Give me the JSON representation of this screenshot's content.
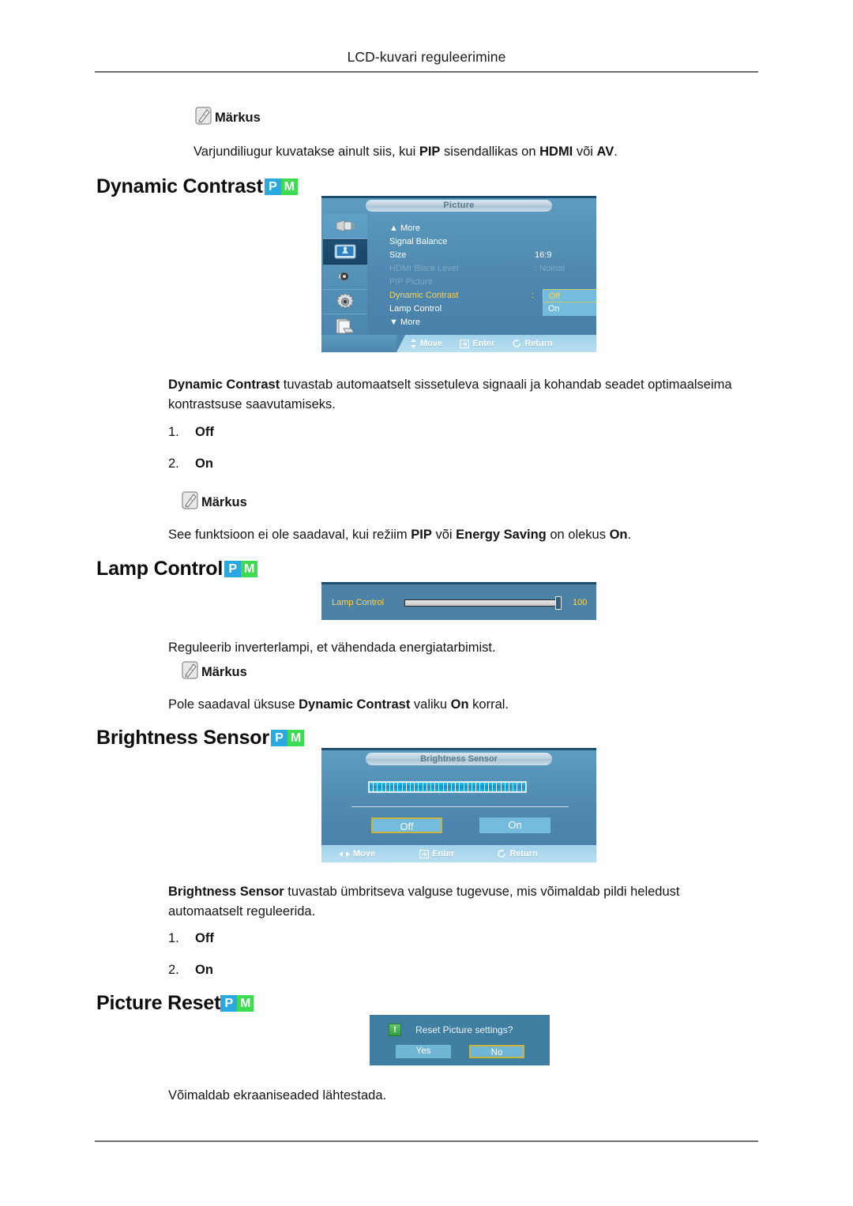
{
  "header": {
    "title": "LCD-kuvari reguleerimine"
  },
  "notes": {
    "label": "Märkus",
    "note1": {
      "pre": "Varjundiliugur kuvatakse ainult siis, kui ",
      "b1": "PIP",
      "mid1": " sisendallikas on ",
      "b2": "HDMI",
      "mid2": " või ",
      "b3": "AV",
      "post": "."
    },
    "note2": {
      "pre": "See funktsioon ei ole saadaval, kui režiim ",
      "b1": "PIP",
      "mid1": " või ",
      "b2": "Energy Saving",
      "mid2": " on olekus ",
      "b3": "On",
      "post": "."
    },
    "note3": {
      "pre": "Pole saadaval üksuse ",
      "b1": "Dynamic Contrast",
      "mid1": " valiku ",
      "b2": "On",
      "mid2": " korral.",
      "b3": "",
      "post": ""
    }
  },
  "badges": {
    "p": "P",
    "m": "M"
  },
  "sections": {
    "dynamic_contrast": {
      "heading": "Dynamic Contrast",
      "desc": {
        "bold": "Dynamic Contrast",
        "rest": " tuvastab automaatselt sissetuleva signaali ja kohandab seadet optimaalseima kontrastsuse saavutamiseks."
      },
      "options": [
        {
          "num": "1.",
          "label": "Off"
        },
        {
          "num": "2.",
          "label": "On"
        }
      ]
    },
    "lamp_control": {
      "heading": "Lamp Control",
      "desc": "Reguleerib inverterlampi, et vähendada energiatarbimist."
    },
    "brightness_sensor": {
      "heading": "Brightness Sensor",
      "desc": {
        "bold": "Brightness Sensor",
        "rest": " tuvastab ümbritseva valguse tugevuse, mis võimaldab pildi heledust automaatselt reguleerida."
      },
      "options": [
        {
          "num": "1.",
          "label": "Off"
        },
        {
          "num": "2.",
          "label": "On"
        }
      ]
    },
    "picture_reset": {
      "heading": "Picture Reset",
      "desc": "Võimaldab ekraaniseaded lähtestada."
    }
  },
  "osd_picture": {
    "title": "Picture",
    "sidebar_icons": [
      "input-plug-icon",
      "picture-screen-icon",
      "sound-speaker-icon",
      "setup-gear-icon",
      "multi-control-icon"
    ],
    "rows": [
      {
        "label": "▲ More",
        "value": ""
      },
      {
        "label": "Signal Balance",
        "value": ""
      },
      {
        "label": "Size",
        "value": "16:9"
      },
      {
        "label": "HDMI Black Level",
        "value": ": Nomal"
      },
      {
        "label": "PIP Picture",
        "value": ""
      },
      {
        "label": "Dynamic Contrast",
        "value": ""
      },
      {
        "label": "Lamp Control",
        "value": ""
      },
      {
        "label": "▼ More",
        "value": ""
      }
    ],
    "dropdown": {
      "colon": ":",
      "selected": "Off",
      "other": "On"
    },
    "footer": [
      {
        "icon": "move-updown-icon",
        "label": "Move"
      },
      {
        "icon": "enter-icon",
        "label": "Enter"
      },
      {
        "icon": "return-icon",
        "label": "Return"
      }
    ]
  },
  "osd_lamp": {
    "label": "Lamp Control",
    "value": "100",
    "slider_percent": 97
  },
  "osd_brightness_sensor": {
    "title": "Brightness Sensor",
    "level_segments": 38,
    "buttons": {
      "off": "Off",
      "on": "On"
    },
    "footer": [
      {
        "icon": "move-leftright-icon",
        "label": "Move"
      },
      {
        "icon": "enter-icon",
        "label": "Enter"
      },
      {
        "icon": "return-icon",
        "label": "Return"
      }
    ]
  },
  "osd_reset": {
    "icon": "warning-icon",
    "question": "Reset Picture settings?",
    "yes": "Yes",
    "no": "No"
  }
}
